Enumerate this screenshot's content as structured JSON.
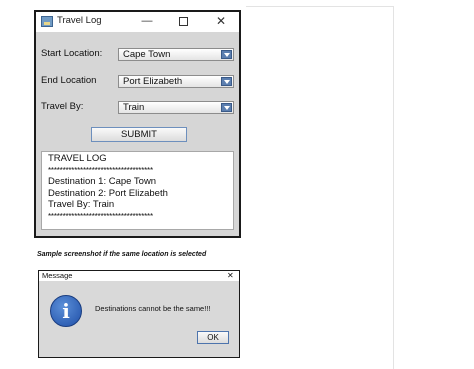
{
  "window": {
    "title": "Travel Log",
    "minimize_glyph": "—",
    "close_glyph": "✕"
  },
  "form": {
    "start_label": "Start Location:",
    "start_value": "Cape Town",
    "end_label": "End Location",
    "end_value": "Port Elizabeth",
    "travel_label": "Travel By:",
    "travel_value": "Train",
    "submit_label": "SUBMIT"
  },
  "log": {
    "heading": "TRAVEL LOG",
    "separator": "************************************",
    "line1": "Destination 1: Cape Town",
    "line2": "Destination 2: Port Elizabeth",
    "line3": "Travel By: Train",
    "separator_bottom": "************************************"
  },
  "caption": "Sample screenshot if the same location is selected",
  "dialog": {
    "title": "Message",
    "close_glyph": "✕",
    "icon_glyph": "i",
    "message": "Destinations cannot be the same!!!",
    "ok_label": "OK"
  },
  "colors": {
    "window_bg": "#d6d6d6",
    "combo_arrow": "#5c7fb0",
    "info_icon": "#2b5fb8"
  }
}
